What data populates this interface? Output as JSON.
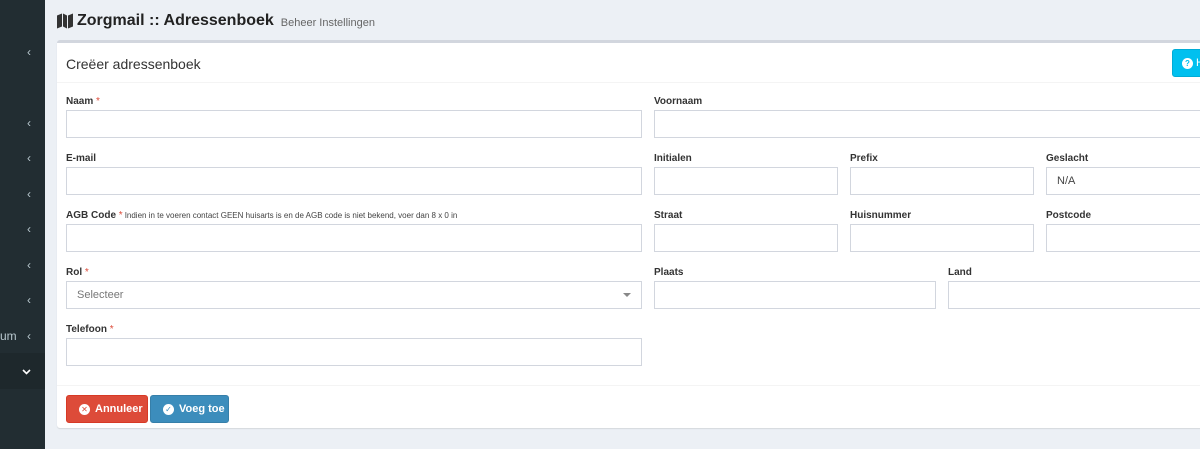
{
  "sidebar": {
    "partial_label": "um",
    "chevron_left": "‹",
    "chevron_down": "⌄"
  },
  "header": {
    "title": "Zorgmail :: Adressenboek",
    "subtitle": "Beheer Instellingen"
  },
  "form": {
    "title": "Creëer adressenboek",
    "help_label": "H",
    "required_mark": "*",
    "fields": {
      "naam": {
        "label": "Naam",
        "value": ""
      },
      "voornaam": {
        "label": "Voornaam",
        "value": ""
      },
      "email": {
        "label": "E-mail",
        "value": ""
      },
      "initialen": {
        "label": "Initialen",
        "value": ""
      },
      "prefix": {
        "label": "Prefix",
        "value": ""
      },
      "geslacht": {
        "label": "Geslacht",
        "value": "N/A"
      },
      "agb": {
        "label": "AGB Code",
        "hint": "Indien in te voeren contact GEEN huisarts is en de AGB code is niet bekend, voer dan 8 x 0 in",
        "value": ""
      },
      "straat": {
        "label": "Straat",
        "value": ""
      },
      "huisnummer": {
        "label": "Huisnummer",
        "value": ""
      },
      "postcode": {
        "label": "Postcode",
        "value": ""
      },
      "rol": {
        "label": "Rol",
        "placeholder": "Selecteer"
      },
      "plaats": {
        "label": "Plaats",
        "value": ""
      },
      "land": {
        "label": "Land",
        "value": ""
      },
      "telefoon": {
        "label": "Telefoon",
        "value": ""
      }
    },
    "buttons": {
      "cancel": "Annuleer",
      "add": "Voeg toe"
    }
  }
}
